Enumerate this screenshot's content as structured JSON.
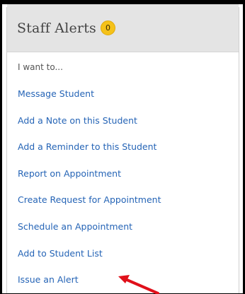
{
  "panel": {
    "title": "Staff Alerts",
    "badge_count": "0",
    "intro": "I want to..."
  },
  "menu": {
    "items": [
      {
        "label": "Message Student"
      },
      {
        "label": "Add a Note on this Student"
      },
      {
        "label": "Add a Reminder to this Student"
      },
      {
        "label": "Report on Appointment"
      },
      {
        "label": "Create Request for Appointment"
      },
      {
        "label": "Schedule an Appointment"
      },
      {
        "label": "Add to Student List"
      },
      {
        "label": "Issue an Alert"
      }
    ]
  },
  "colors": {
    "link": "#2564b6",
    "badge": "#f5c21a",
    "header_bg": "#e4e4e4",
    "arrow": "#e0101a"
  }
}
